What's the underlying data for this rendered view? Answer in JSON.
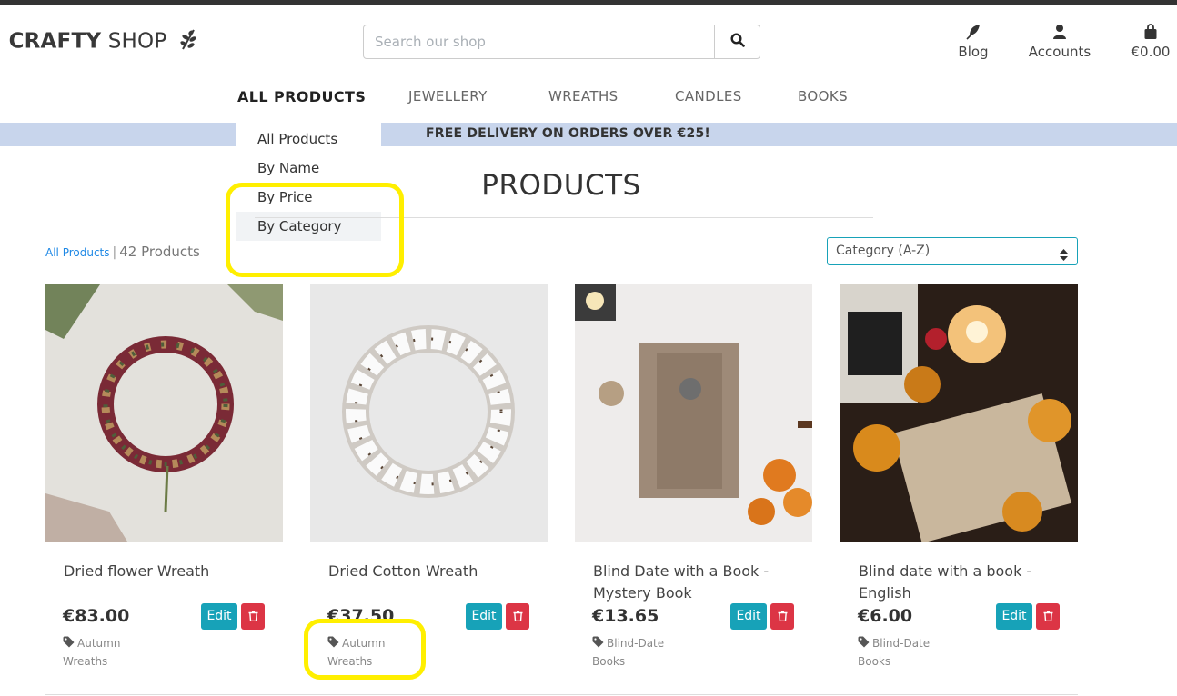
{
  "header": {
    "brand_part1": "HE CRAFTY",
    "brand_part2": " SHOP",
    "search_placeholder": "Search our shop",
    "blog_label": "Blog",
    "accounts_label": "Accounts",
    "cart_total": "€0.00"
  },
  "nav": {
    "items": [
      "ALL PRODUCTS",
      "JEWELLERY",
      "WREATHS",
      "CANDLES",
      "BOOKS"
    ],
    "active": "ALL PRODUCTS"
  },
  "dropdown": {
    "items": [
      "All Products",
      "By Name",
      "By Price",
      "By Category"
    ],
    "highlighted": "By Category"
  },
  "banner": {
    "text": "FREE DELIVERY ON ORDERS OVER €25!"
  },
  "page": {
    "title": "PRODUCTS",
    "breadcrumb_link": "All Products",
    "breadcrumb_sep": "|",
    "product_count": "42 Products",
    "sort_value": "Category (A-Z)"
  },
  "products": [
    {
      "name": "Dried flower Wreath",
      "price": "€83.00",
      "category_line1": "Autumn",
      "category_line2": "Wreaths",
      "edit_label": "Edit"
    },
    {
      "name": "Dried Cotton Wreath",
      "price": "€37.50",
      "category_line1": "Autumn",
      "category_line2": "Wreaths",
      "edit_label": "Edit"
    },
    {
      "name": "Blind Date with a Book - Mystery Book",
      "price": "€13.65",
      "category_line1": "Blind-Date",
      "category_line2": "Books",
      "edit_label": "Edit"
    },
    {
      "name": "Blind date with a book - English",
      "price": "€6.00",
      "category_line1": "Blind-Date",
      "category_line2": "Books",
      "edit_label": "Edit"
    }
  ],
  "colors": {
    "banner_bg": "#c8d5ec",
    "edit_button": "#17a2b8",
    "delete_button": "#dc3545",
    "highlight_annotation": "#ffef00",
    "link": "#1e88e5"
  },
  "icons": {
    "brand": "leaf-sprig-icon",
    "search": "search-icon",
    "blog": "feather-icon",
    "accounts": "user-icon",
    "cart": "shopping-bag-icon",
    "sort": "sort-arrows-icon",
    "delete": "trash-icon",
    "category": "tag-icon"
  }
}
